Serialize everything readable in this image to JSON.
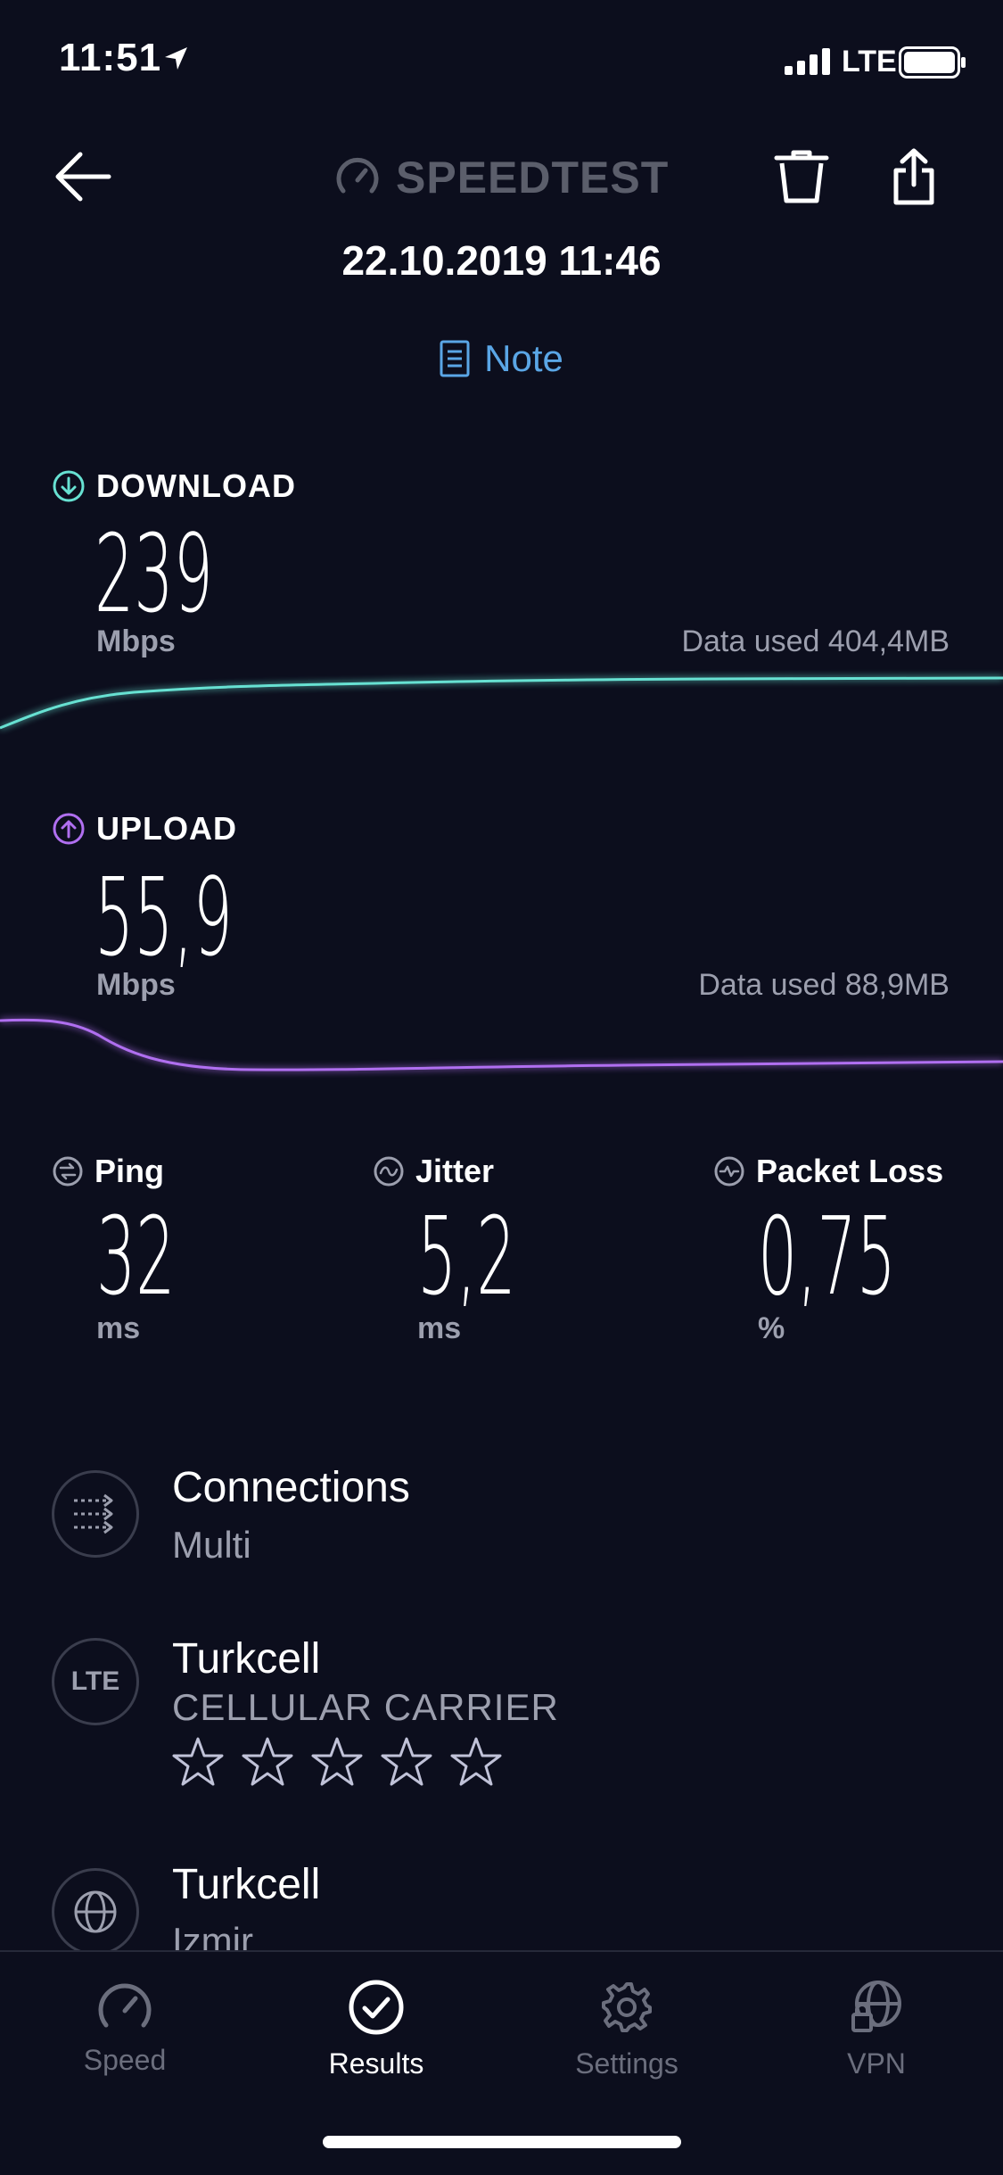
{
  "status_bar": {
    "time": "11:51",
    "network": "LTE"
  },
  "header": {
    "logo": "SPEEDTEST",
    "date": "22.10.2019 11:46",
    "note_label": "Note"
  },
  "download": {
    "label": "DOWNLOAD",
    "value": "239",
    "unit": "Mbps",
    "data_used": "Data used 404,4MB",
    "color": "#67e1d2"
  },
  "upload": {
    "label": "UPLOAD",
    "value": "55,9",
    "unit": "Mbps",
    "data_used": "Data used 88,9MB",
    "color": "#b06ff0"
  },
  "metrics": [
    {
      "label": "Ping",
      "value": "32",
      "unit": "ms"
    },
    {
      "label": "Jitter",
      "value": "5,2",
      "unit": "ms"
    },
    {
      "label": "Packet Loss",
      "value": "0,75",
      "unit": "%"
    }
  ],
  "info": [
    {
      "title": "Connections",
      "subtitle": "Multi",
      "icon": "connections-icon"
    },
    {
      "title": "Turkcell",
      "subtitle": "CELLULAR CARRIER",
      "icon_text": "LTE",
      "rating_stars": 5,
      "rating_value": 0
    },
    {
      "title": "Turkcell",
      "subtitle": "Izmir",
      "icon": "globe-icon"
    }
  ],
  "tabs": [
    {
      "label": "Speed",
      "icon": "speedometer-icon",
      "active": false
    },
    {
      "label": "Results",
      "icon": "check-circle-icon",
      "active": true
    },
    {
      "label": "Settings",
      "icon": "gear-icon",
      "active": false
    },
    {
      "label": "VPN",
      "icon": "vpn-globe-lock-icon",
      "active": false
    }
  ],
  "colors": {
    "background": "#0c0e1d",
    "accent_blue": "#5aa6e6",
    "muted": "#9c9fae"
  }
}
